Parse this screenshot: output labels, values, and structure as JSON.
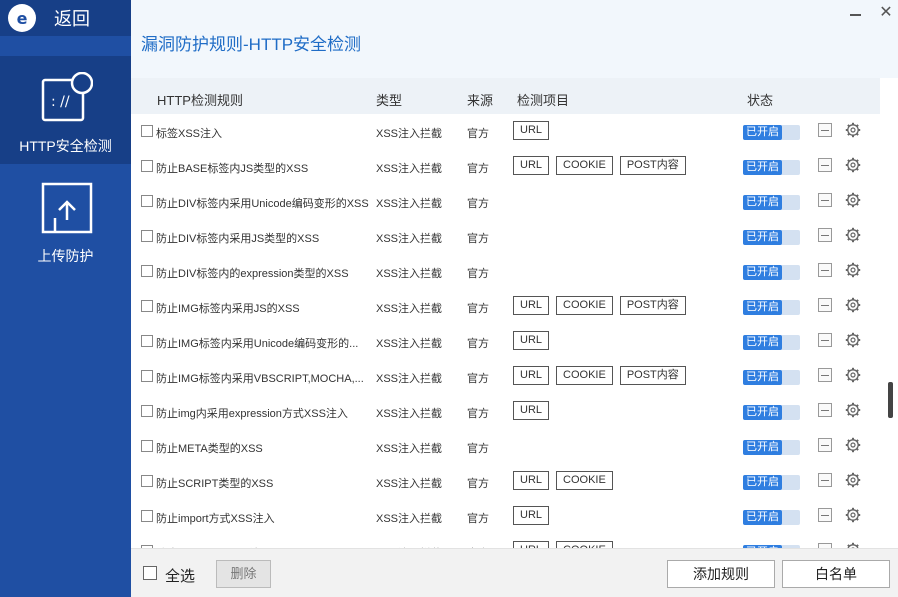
{
  "nav": {
    "back_label": "返回",
    "logo_letter": "e",
    "items": [
      {
        "label": "HTTP安全检测",
        "icon": "http-security-icon",
        "active": true
      },
      {
        "label": "上传防护",
        "icon": "upload-protection-icon",
        "active": false
      }
    ]
  },
  "page_title": "漏洞防护规则-HTTP安全检测",
  "table": {
    "headers": {
      "rule": "HTTP检测规则",
      "type": "类型",
      "source": "来源",
      "items": "检测项目",
      "status": "状态"
    },
    "rows": [
      {
        "name": "标签XSS注入",
        "type": "XSS注入拦截",
        "source": "官方",
        "items": [
          "URL"
        ],
        "status": "已开启"
      },
      {
        "name": "防止BASE标签内JS类型的XSS",
        "type": "XSS注入拦截",
        "source": "官方",
        "items": [
          "URL",
          "COOKIE",
          "POST内容"
        ],
        "status": "已开启"
      },
      {
        "name": "防止DIV标签内采用Unicode编码变形的XSS",
        "type": "XSS注入拦截",
        "source": "官方",
        "items": [],
        "status": "已开启"
      },
      {
        "name": "防止DIV标签内采用JS类型的XSS",
        "type": "XSS注入拦截",
        "source": "官方",
        "items": [],
        "status": "已开启"
      },
      {
        "name": "防止DIV标签内的expression类型的XSS",
        "type": "XSS注入拦截",
        "source": "官方",
        "items": [],
        "status": "已开启"
      },
      {
        "name": "防止IMG标签内采用JS的XSS",
        "type": "XSS注入拦截",
        "source": "官方",
        "items": [
          "URL",
          "COOKIE",
          "POST内容"
        ],
        "status": "已开启"
      },
      {
        "name": "防止IMG标签内采用Unicode编码变形的...",
        "type": "XSS注入拦截",
        "source": "官方",
        "items": [
          "URL"
        ],
        "status": "已开启"
      },
      {
        "name": "防止IMG标签内采用VBSCRIPT,MOCHA,...",
        "type": "XSS注入拦截",
        "source": "官方",
        "items": [
          "URL",
          "COOKIE",
          "POST内容"
        ],
        "status": "已开启"
      },
      {
        "name": "防止img内采用expression方式XSS注入",
        "type": "XSS注入拦截",
        "source": "官方",
        "items": [
          "URL"
        ],
        "status": "已开启"
      },
      {
        "name": "防止META类型的XSS",
        "type": "XSS注入拦截",
        "source": "官方",
        "items": [],
        "status": "已开启"
      },
      {
        "name": "防止SCRIPT类型的XSS",
        "type": "XSS注入拦截",
        "source": "官方",
        "items": [
          "URL",
          "COOKIE"
        ],
        "status": "已开启"
      },
      {
        "name": "防止import方式XSS注入",
        "type": "XSS注入拦截",
        "source": "官方",
        "items": [
          "URL"
        ],
        "status": "已开启"
      },
      {
        "name": "防止javascript XSS注入",
        "type": "XSS注入拦截",
        "source": "官方",
        "items": [
          "URL",
          "COOKIE"
        ],
        "status": "已开启"
      }
    ]
  },
  "footer": {
    "select_all": "全选",
    "delete": "删除",
    "add_rule": "添加规则",
    "whitelist": "白名单"
  },
  "colors": {
    "sidebar": "#1f4fa3",
    "sidebar_active": "#173f87",
    "title": "#1f6cc6",
    "status_on": "#2f7ee0"
  }
}
